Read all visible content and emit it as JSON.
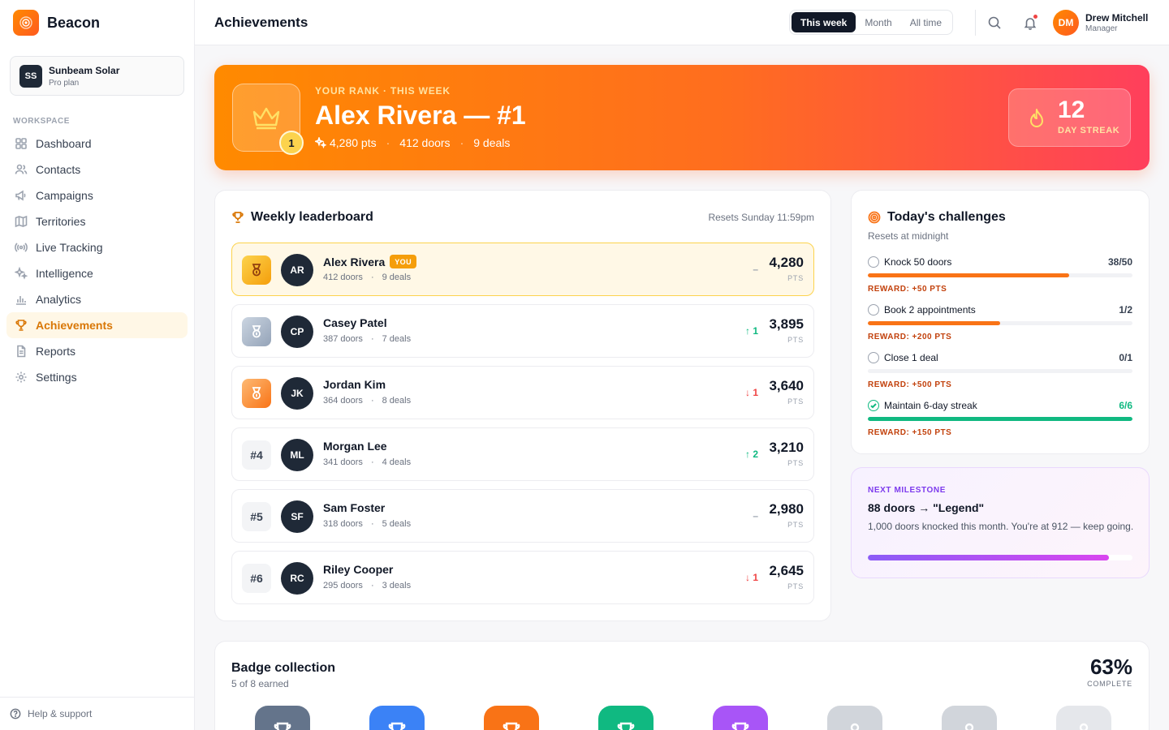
{
  "brand": {
    "name": "Beacon"
  },
  "org": {
    "initials": "SS",
    "name": "Sunbeam Solar",
    "plan": "Pro plan"
  },
  "nav": {
    "section": "WORKSPACE",
    "items": [
      {
        "label": "Dashboard",
        "icon": "grid-icon"
      },
      {
        "label": "Contacts",
        "icon": "users-icon"
      },
      {
        "label": "Campaigns",
        "icon": "megaphone-icon"
      },
      {
        "label": "Territories",
        "icon": "map-icon"
      },
      {
        "label": "Live Tracking",
        "icon": "radio-icon"
      },
      {
        "label": "Intelligence",
        "icon": "sparkles-icon"
      },
      {
        "label": "Analytics",
        "icon": "bar-chart-icon"
      },
      {
        "label": "Achievements",
        "icon": "trophy-icon",
        "active": true
      },
      {
        "label": "Reports",
        "icon": "file-icon"
      },
      {
        "label": "Settings",
        "icon": "gear-icon"
      }
    ],
    "help": "Help & support"
  },
  "header": {
    "title": "Achievements",
    "periods": [
      "This week",
      "Month",
      "All time"
    ],
    "active_period": "This week",
    "user": {
      "initials": "DM",
      "name": "Drew Mitchell",
      "role": "Manager"
    }
  },
  "hero": {
    "eyebrow": "YOUR RANK · THIS WEEK",
    "title": "Alex Rivera — #1",
    "rank": "1",
    "points": "4,280 pts",
    "doors": "412 doors",
    "deals": "9 deals",
    "streak_num": "12",
    "streak_label": "DAY STREAK"
  },
  "leaderboard": {
    "title": "Weekly leaderboard",
    "subtitle": "Resets Sunday 11:59pm",
    "you_label": "YOU",
    "pts_label": "PTS",
    "rows": [
      {
        "rank": "",
        "medal": "gold",
        "initials": "AR",
        "name": "Alex Rivera",
        "you": true,
        "doors": "412 doors",
        "deals": "9 deals",
        "delta": "–",
        "dir": "flat",
        "points": "4,280"
      },
      {
        "rank": "",
        "medal": "silver",
        "initials": "CP",
        "name": "Casey Patel",
        "you": false,
        "doors": "387 doors",
        "deals": "7 deals",
        "delta": "↑ 1",
        "dir": "up",
        "points": "3,895"
      },
      {
        "rank": "",
        "medal": "bronze",
        "initials": "JK",
        "name": "Jordan Kim",
        "you": false,
        "doors": "364 doors",
        "deals": "8 deals",
        "delta": "↓ 1",
        "dir": "down",
        "points": "3,640"
      },
      {
        "rank": "#4",
        "medal": "num",
        "initials": "ML",
        "name": "Morgan Lee",
        "you": false,
        "doors": "341 doors",
        "deals": "4 deals",
        "delta": "↑ 2",
        "dir": "up",
        "points": "3,210"
      },
      {
        "rank": "#5",
        "medal": "num",
        "initials": "SF",
        "name": "Sam Foster",
        "you": false,
        "doors": "318 doors",
        "deals": "5 deals",
        "delta": "–",
        "dir": "flat",
        "points": "2,980"
      },
      {
        "rank": "#6",
        "medal": "num",
        "initials": "RC",
        "name": "Riley Cooper",
        "you": false,
        "doors": "295 doors",
        "deals": "3 deals",
        "delta": "↓ 1",
        "dir": "down",
        "points": "2,645"
      }
    ]
  },
  "challenges": {
    "title": "Today's challenges",
    "subtitle": "Resets at midnight",
    "items": [
      {
        "name": "Knock 50 doors",
        "progress": "38/50",
        "fraction": 0.76,
        "reward": "REWARD: +50 PTS",
        "done": false
      },
      {
        "name": "Book 2 appointments",
        "progress": "1/2",
        "fraction": 0.5,
        "reward": "REWARD: +200 PTS",
        "done": false
      },
      {
        "name": "Close 1 deal",
        "progress": "0/1",
        "fraction": 0,
        "reward": "REWARD: +500 PTS",
        "done": false
      },
      {
        "name": "Maintain 6-day streak",
        "progress": "6/6",
        "fraction": 1,
        "reward": "REWARD: +150 PTS",
        "done": true
      }
    ]
  },
  "milestone": {
    "eyebrow": "NEXT MILESTONE",
    "title": "88 doors → \"Legend\"",
    "description": "1,000 doors knocked this month. You're at 912 — keep going.",
    "fraction": 0.912
  },
  "badges": {
    "title": "Badge collection",
    "subtitle": "5 of 8 earned",
    "percent": "63%",
    "percent_label": "COMPLETE",
    "colors": [
      "#64748b",
      "#3b82f6",
      "#f97316",
      "#10b981",
      "#a855f7",
      "#d1d5db",
      "#d1d5db",
      "#e5e7eb"
    ]
  }
}
